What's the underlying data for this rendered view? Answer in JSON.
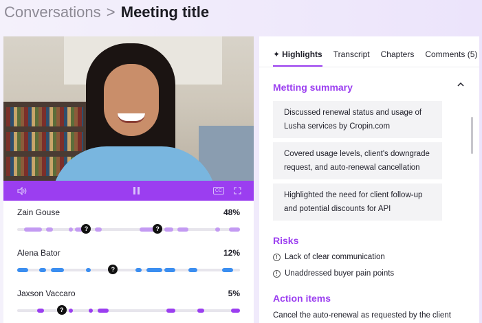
{
  "breadcrumb": {
    "root": "Conversations",
    "separator": ">",
    "current": "Meeting title"
  },
  "player": {
    "cc_label": "CC"
  },
  "speakers": [
    {
      "name": "Zain Gouse",
      "percent": "48%",
      "color": "#c39af2",
      "segments": [
        [
          3,
          11
        ],
        [
          13,
          16
        ],
        [
          23,
          25
        ],
        [
          26,
          32
        ],
        [
          35,
          38
        ],
        [
          55,
          63
        ],
        [
          66,
          70
        ],
        [
          72,
          77
        ],
        [
          89,
          91
        ],
        [
          95,
          100
        ]
      ],
      "markers": [
        [
          31,
          "?"
        ],
        [
          63,
          "?"
        ]
      ]
    },
    {
      "name": "Alena Bator",
      "percent": "12%",
      "color": "#3b8ef0",
      "segments": [
        [
          0,
          5
        ],
        [
          10,
          13
        ],
        [
          15,
          21
        ],
        [
          31,
          33
        ],
        [
          53,
          56
        ],
        [
          58,
          65
        ],
        [
          66,
          71
        ],
        [
          77,
          81
        ],
        [
          92,
          97
        ]
      ],
      "markers": [
        [
          43,
          "?"
        ]
      ]
    },
    {
      "name": "Jaxson Vaccaro",
      "percent": "5%",
      "color": "#9b3ef0",
      "segments": [
        [
          9,
          12
        ],
        [
          23,
          25
        ],
        [
          32,
          34
        ],
        [
          36,
          41
        ],
        [
          67,
          71
        ],
        [
          81,
          84
        ],
        [
          96,
          100
        ]
      ],
      "markers": [
        [
          20,
          "?"
        ]
      ]
    }
  ],
  "tabs": [
    {
      "label": "Highlights",
      "active": true
    },
    {
      "label": "Transcript",
      "active": false
    },
    {
      "label": "Chapters",
      "active": false
    },
    {
      "label": "Comments (5)",
      "active": false
    }
  ],
  "summary": {
    "title": "Metting summary",
    "cards": [
      "Discussed renewal status and usage of Lusha services by Cropin.com",
      "Covered  usage levels, client's downgrade request, and auto-renewal cancellation",
      "Highlighted the need for client follow-up and potential discounts for API"
    ]
  },
  "risks": {
    "title": "Risks",
    "items": [
      "Lack of clear communication",
      "Unaddressed buyer pain points"
    ]
  },
  "actions": {
    "title": "Action items",
    "items": [
      "Cancel the auto-renewal as requested by the client"
    ]
  },
  "icons": {
    "volume": "speaker-icon",
    "pause": "pause-icon",
    "cc": "closed-captions-icon",
    "fullscreen": "fullscreen-icon",
    "sparkle": "sparkle-icon",
    "collapse": "chevron-up-icon",
    "alert": "alert-circle-icon"
  }
}
